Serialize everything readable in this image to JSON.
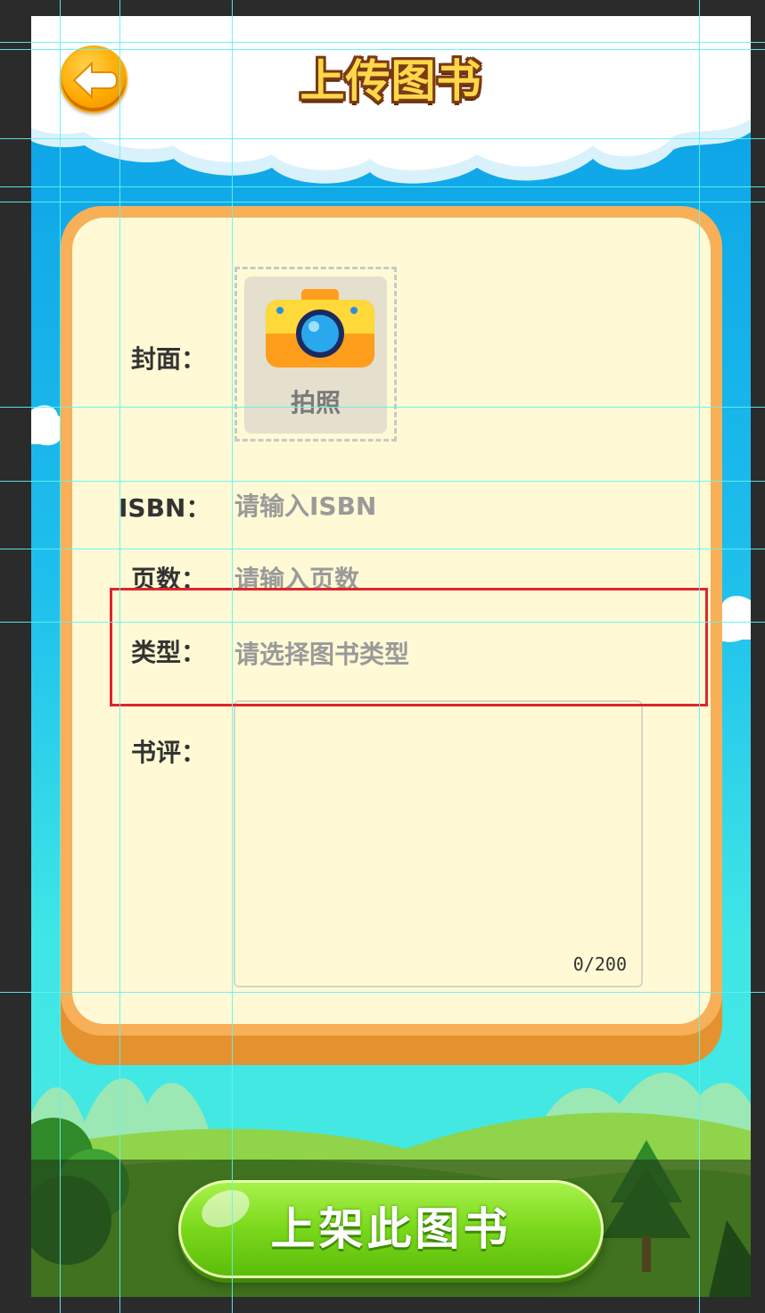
{
  "header": {
    "title": "上传图书"
  },
  "form": {
    "cover_label": "封面：",
    "photo_label": "拍照",
    "isbn_label": "ISBN：",
    "isbn_placeholder": "请输入ISBN",
    "pages_label": "页数：",
    "pages_placeholder": "请输入页数",
    "type_label": "类型：",
    "type_placeholder": "请选择图书类型",
    "review_label": "书评：",
    "review_counter": "0/200"
  },
  "footer": {
    "submit_label": "上架此图书"
  },
  "colors": {
    "panel_border": "#f7b057",
    "panel_fill": "#fffad5",
    "title": "#ffd84a",
    "submit": "#7ad81b",
    "selection": "#e0252a",
    "guides": "#5ff3f3"
  },
  "icons": [
    "back-arrow-icon",
    "camera-icon"
  ]
}
